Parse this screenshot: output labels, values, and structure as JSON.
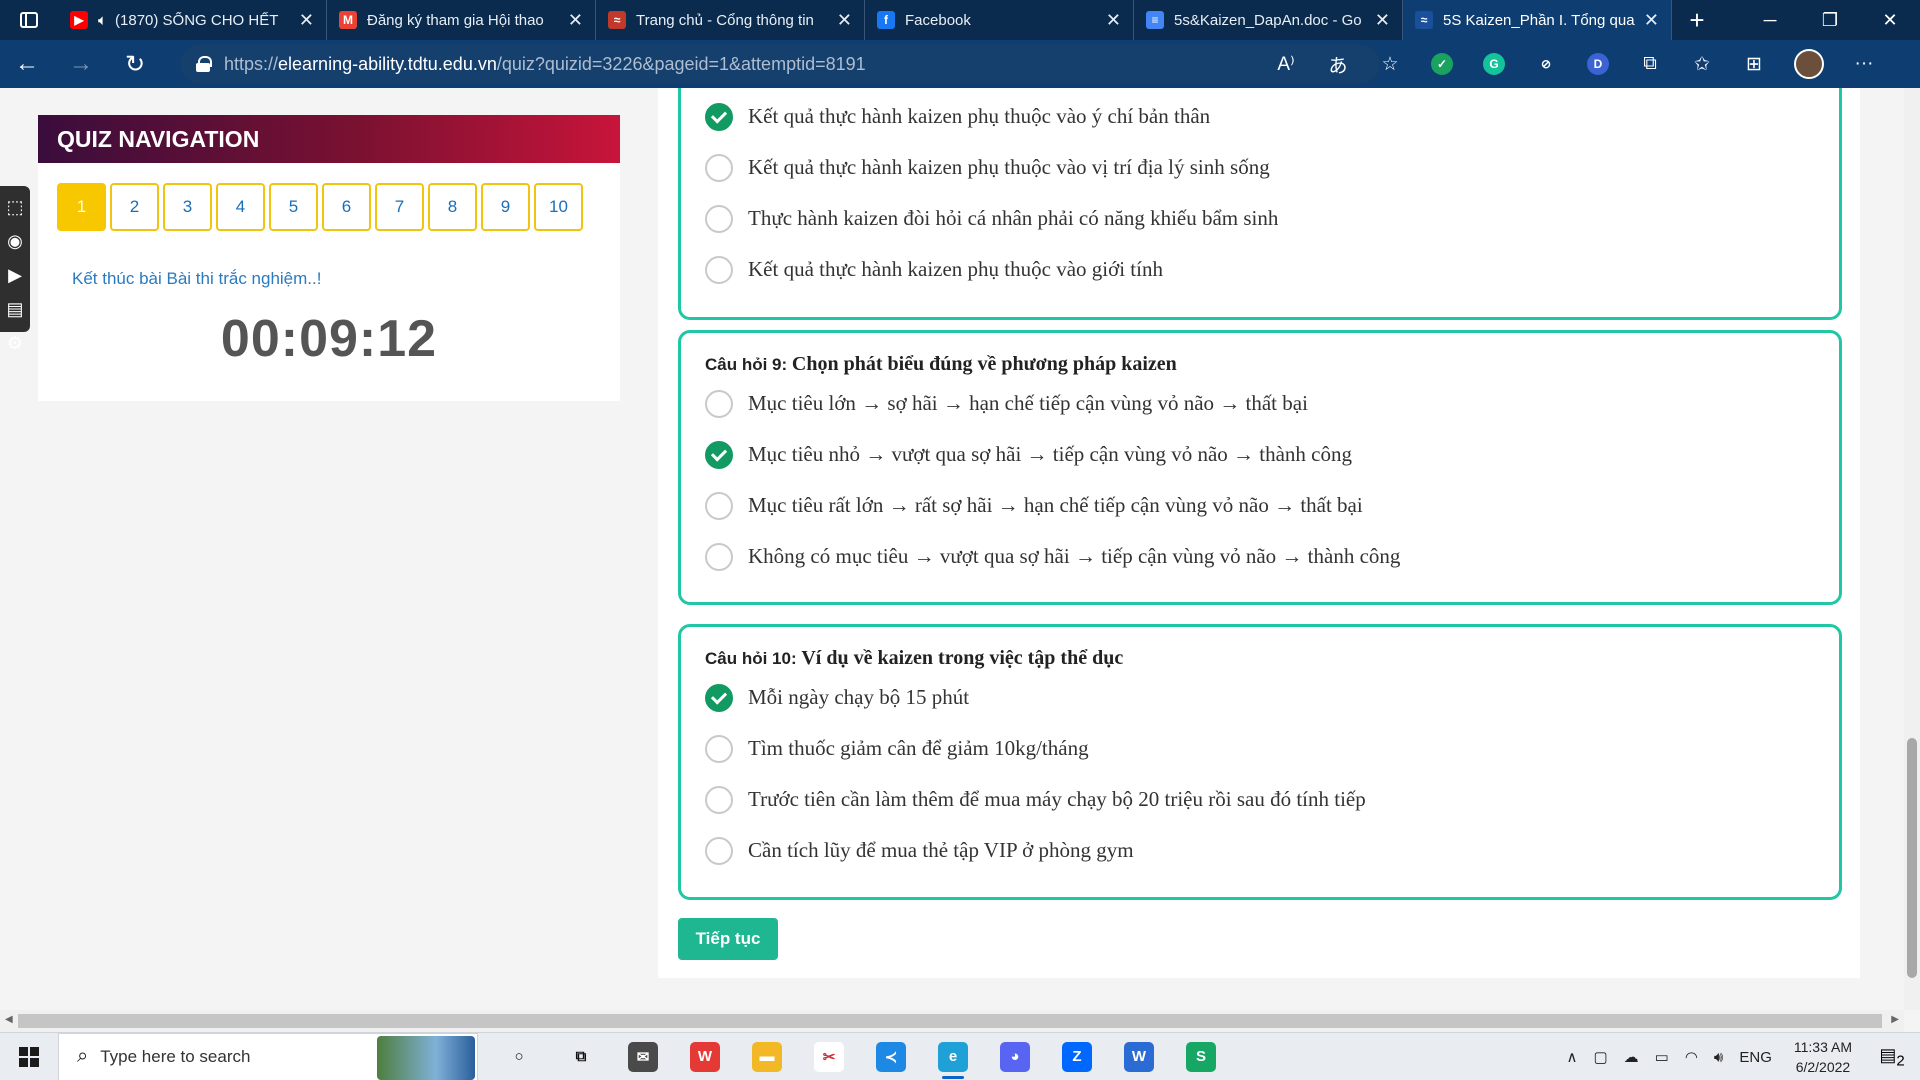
{
  "browser": {
    "tabs": [
      {
        "title": "(1870) SỐNG CHO HẾT",
        "favicon_color": "#ff0000",
        "favicon_glyph": "▶",
        "has_audio": true,
        "active": false
      },
      {
        "title": "Đăng ký tham gia Hội thao",
        "favicon_color": "#ea4335",
        "favicon_glyph": "M",
        "active": false
      },
      {
        "title": "Trang chủ - Cổng thông tin",
        "favicon_color": "#c0392b",
        "favicon_glyph": "≈",
        "active": false
      },
      {
        "title": "Facebook",
        "favicon_color": "#1877f2",
        "favicon_glyph": "f",
        "active": false
      },
      {
        "title": "5s&Kaizen_DapAn.doc - Go",
        "favicon_color": "#4285f4",
        "favicon_glyph": "≡",
        "active": false
      },
      {
        "title": "5S Kaizen_Phần I. Tổng qua",
        "favicon_color": "#1a4f9c",
        "favicon_glyph": "≈",
        "active": true
      }
    ],
    "url_prefix": "https://",
    "url_host": "elearning-ability.tdtu.edu.vn",
    "url_path": "/quiz?quizid=3226&pageid=1&attemptid=8191",
    "extensions": [
      {
        "name": "shield-ext",
        "color": "#1aa260",
        "glyph": "✓"
      },
      {
        "name": "grammarly-ext",
        "color": "#15c39a",
        "glyph": "G"
      },
      {
        "name": "compass-ext",
        "color": "#0e3d71",
        "glyph": "⊘"
      },
      {
        "name": "d-ext",
        "color": "#3b63d4",
        "glyph": "D"
      }
    ]
  },
  "sidebar_tools": [
    "⬚",
    "◉",
    "▶",
    "▤",
    "⚙"
  ],
  "quiz_nav": {
    "header": "QUIZ NAVIGATION",
    "questions": [
      "1",
      "2",
      "3",
      "4",
      "5",
      "6",
      "7",
      "8",
      "9",
      "10"
    ],
    "current": "1",
    "finish_link": "Kết thúc bài Bài thi trắc nghiệm..!",
    "timer": "00:09:12"
  },
  "questions": [
    {
      "number_label": "",
      "title": "",
      "answers": [
        {
          "text": "Kết quả thực hành kaizen phụ thuộc vào ý chí bản thân",
          "checked": true
        },
        {
          "text": "Kết quả thực hành kaizen phụ thuộc vào vị trí địa lý sinh sống",
          "checked": false
        },
        {
          "text": "Thực hành kaizen đòi hỏi cá nhân phải có năng khiếu bẩm sinh",
          "checked": false
        },
        {
          "text": "Kết quả thực hành kaizen phụ thuộc vào giới tính",
          "checked": false
        }
      ]
    },
    {
      "number_label": "Câu hỏi 9:",
      "title": "Chọn phát biểu đúng về phương pháp kaizen",
      "answers": [
        {
          "text": "Mục tiêu lớn → sợ hãi → hạn chế tiếp cận vùng vỏ não → thất bại",
          "checked": false
        },
        {
          "text": "Mục tiêu nhỏ → vượt qua sợ hãi → tiếp cận vùng vỏ não → thành công",
          "checked": true
        },
        {
          "text": "Mục tiêu rất lớn → rất sợ hãi → hạn chế tiếp cận vùng vỏ não → thất bại",
          "checked": false
        },
        {
          "text": "Không có mục tiêu → vượt qua sợ hãi → tiếp cận vùng vỏ não → thành công",
          "checked": false
        }
      ]
    },
    {
      "number_label": "Câu hỏi 10:",
      "title": "Ví dụ về kaizen trong việc tập thể dục",
      "answers": [
        {
          "text": "Mỗi ngày chạy bộ 15 phút",
          "checked": true
        },
        {
          "text": "Tìm thuốc giảm cân để giảm 10kg/tháng",
          "checked": false
        },
        {
          "text": "Trước tiên cần làm thêm để mua máy chạy bộ 20 triệu rồi sau đó tính tiếp",
          "checked": false
        },
        {
          "text": "Cần tích lũy để mua thẻ tập VIP ở phòng gym",
          "checked": false
        }
      ]
    }
  ],
  "continue_label": "Tiếp tục",
  "taskbar": {
    "search_placeholder": "Type here to search",
    "apps": [
      {
        "name": "cortana-icon",
        "color": "#e9edf2",
        "glyph": "○",
        "fg": "#111"
      },
      {
        "name": "task-view-icon",
        "color": "#e9edf2",
        "glyph": "⧉",
        "fg": "#111"
      },
      {
        "name": "mail-icon",
        "color": "#4a4a4a",
        "glyph": "✉",
        "fg": "#fff"
      },
      {
        "name": "wps-icon",
        "color": "#e53935",
        "glyph": "W",
        "fg": "#fff"
      },
      {
        "name": "file-explorer-icon",
        "color": "#f2b825",
        "glyph": "▬",
        "fg": "#fff"
      },
      {
        "name": "snipping-tool-icon",
        "color": "#fff",
        "glyph": "✂",
        "fg": "#d32f2f"
      },
      {
        "name": "vscode-icon",
        "color": "#1e88e5",
        "glyph": "≺",
        "fg": "#fff"
      },
      {
        "name": "edge-icon",
        "color": "#1fa0d6",
        "glyph": "e",
        "fg": "#fff",
        "active": true
      },
      {
        "name": "discord-icon",
        "color": "#5865f2",
        "glyph": "◕",
        "fg": "#fff"
      },
      {
        "name": "zalo-icon",
        "color": "#0068ff",
        "glyph": "Z",
        "fg": "#fff"
      },
      {
        "name": "word-icon",
        "color": "#2b6cd4",
        "glyph": "W",
        "fg": "#fff"
      },
      {
        "name": "sheets-icon",
        "color": "#16a765",
        "glyph": "S",
        "fg": "#fff"
      }
    ],
    "language": "ENG",
    "time": "11:33 AM",
    "date": "6/2/2022",
    "notification_count": "2"
  }
}
